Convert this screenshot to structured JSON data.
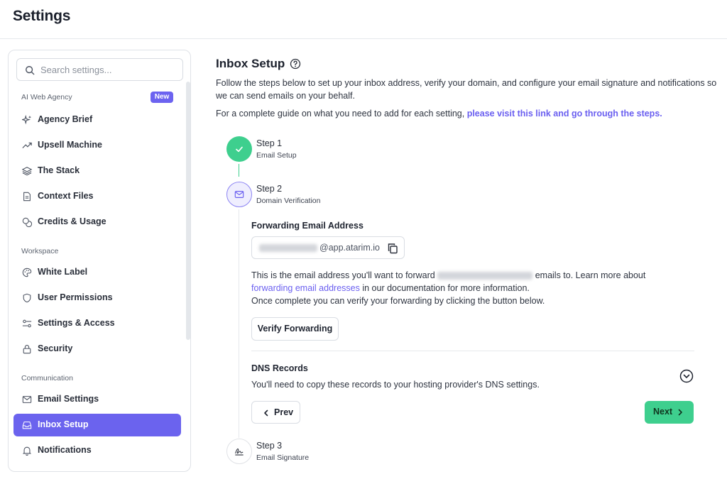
{
  "header": {
    "title": "Settings"
  },
  "sidebar": {
    "search_placeholder": "Search settings...",
    "sections": [
      {
        "label": "AI Web Agency",
        "badge": "New"
      },
      {
        "label": "Workspace"
      },
      {
        "label": "Communication"
      }
    ],
    "items": [
      {
        "label": "Agency Brief",
        "icon": "sparkles-icon"
      },
      {
        "label": "Upsell Machine",
        "icon": "trending-up-icon"
      },
      {
        "label": "The Stack",
        "icon": "layers-icon"
      },
      {
        "label": "Context Files",
        "icon": "file-icon"
      },
      {
        "label": "Credits & Usage",
        "icon": "coins-icon"
      },
      {
        "label": "White Label",
        "icon": "palette-icon"
      },
      {
        "label": "User Permissions",
        "icon": "shield-icon"
      },
      {
        "label": "Settings & Access",
        "icon": "sliders-icon"
      },
      {
        "label": "Security",
        "icon": "lock-icon"
      },
      {
        "label": "Email Settings",
        "icon": "mail-icon"
      },
      {
        "label": "Inbox Setup",
        "icon": "inbox-icon",
        "active": true
      },
      {
        "label": "Notifications",
        "icon": "bell-icon"
      }
    ],
    "active_color": "#6b63ee"
  },
  "main": {
    "title": "Inbox Setup",
    "intro_1": "Follow the steps below to set up your inbox address, verify your domain, and configure your email signature and notifications so",
    "intro_2": "we can send emails on your behalf.",
    "guide_prefix": "For a complete guide on what you need to add for each setting, ",
    "guide_link": "please visit this link and go through the steps.",
    "steps": [
      {
        "title": "Step 1",
        "subtitle": "Email Setup",
        "status": "complete"
      },
      {
        "title": "Step 2",
        "subtitle": "Domain Verification",
        "status": "active"
      },
      {
        "title": "Step 3",
        "subtitle": "Email Signature",
        "status": "pending"
      }
    ],
    "forwarding": {
      "label": "Forwarding Email Address",
      "domain": "@app.atarim.io",
      "text_1a": "This is the email address you'll want to forward",
      "text_1b": "emails to. Learn more about",
      "link": "forwarding email addresses",
      "text_2": " in our documentation for more information.",
      "text_3": "Once complete you can verify your forwarding by clicking the button below.",
      "verify_button": "Verify Forwarding"
    },
    "dns": {
      "title": "DNS Records",
      "text": "You'll need to copy these records to your hosting provider's DNS settings."
    },
    "prev_button": "Prev",
    "next_button": "Next",
    "success_color": "#3ecf8e",
    "link_color": "#6a5ff0"
  }
}
